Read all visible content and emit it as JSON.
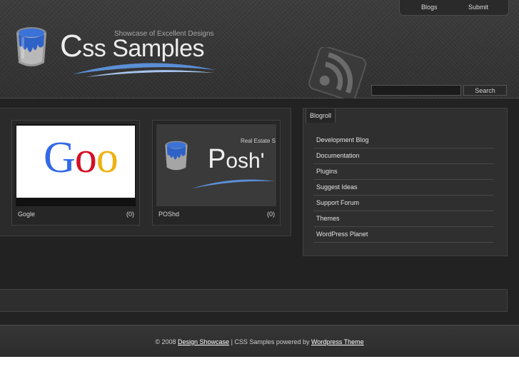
{
  "nav": {
    "blogs": "Blogs",
    "submit": "Submit"
  },
  "logo": {
    "first_letter": "C",
    "rest": "ss Samples",
    "tagline": "Showcase of Excellent Designs"
  },
  "search": {
    "button": "Search",
    "value": ""
  },
  "showcase": {
    "cards": [
      {
        "title": "Gogle",
        "count": "(0)",
        "thumb_text": "Goo"
      },
      {
        "title": "POShd",
        "count": "(0)",
        "thumb_text": "Posh",
        "thumb_first": "P",
        "thumb_rest": "osh'",
        "thumb_sub": "Real Estate S"
      }
    ]
  },
  "sidebar": {
    "tab": "Blogroll",
    "items": [
      {
        "label": "Development Blog"
      },
      {
        "label": "Documentation"
      },
      {
        "label": "Plugins"
      },
      {
        "label": "Suggest Ideas"
      },
      {
        "label": "Support Forum"
      },
      {
        "label": "Themes"
      },
      {
        "label": "WordPress Planet"
      }
    ]
  },
  "footer": {
    "prefix": "© 2008",
    "link1": "Design Showcase",
    "middle": "| CSS Samples powered by",
    "link2": "Wordpress Theme"
  },
  "colors": {
    "google_blue": "#3369e8",
    "google_red": "#d50f25",
    "google_yellow": "#eeb211",
    "swoosh": "#5b8fd6"
  }
}
